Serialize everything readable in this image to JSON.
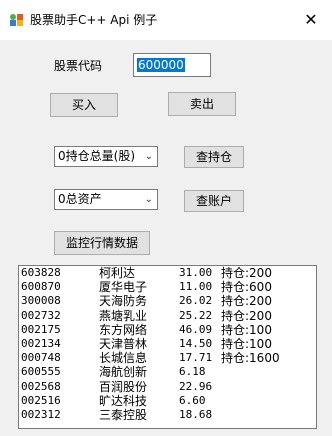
{
  "window": {
    "title": "股票助手C++ Api 例子",
    "close_label": "✕"
  },
  "form": {
    "stock_code_label": "股票代码",
    "stock_code_value": "600000",
    "buy_label": "买入",
    "sell_label": "卖出",
    "position_select_value": "0持仓总量(股)",
    "query_position_label": "查持仓",
    "asset_select_value": "0总资产",
    "query_account_label": "查账户",
    "monitor_label": "监控行情数据"
  },
  "list": {
    "rows": [
      {
        "code": "603828",
        "name": "柯利达",
        "price": "31.00",
        "hold": "持仓:200"
      },
      {
        "code": "600870",
        "name": "厦华电子",
        "price": "11.00",
        "hold": "持仓:600"
      },
      {
        "code": "300008",
        "name": "天海防务",
        "price": "26.02",
        "hold": "持仓:200"
      },
      {
        "code": "002732",
        "name": "燕塘乳业",
        "price": "25.22",
        "hold": "持仓:200"
      },
      {
        "code": "002175",
        "name": "东方网络",
        "price": "46.09",
        "hold": "持仓:100"
      },
      {
        "code": "002134",
        "name": "天津普林",
        "price": "14.50",
        "hold": "持仓:100"
      },
      {
        "code": "000748",
        "name": "长城信息",
        "price": "17.71",
        "hold": "持仓:1600"
      },
      {
        "code": "600555",
        "name": "海航创新",
        "price": "6.18",
        "hold": ""
      },
      {
        "code": "002568",
        "name": "百润股份",
        "price": "22.96",
        "hold": ""
      },
      {
        "code": "002516",
        "name": "旷达科技",
        "price": "6.60",
        "hold": ""
      },
      {
        "code": "002312",
        "name": "三泰控股",
        "price": "18.68",
        "hold": ""
      }
    ]
  }
}
